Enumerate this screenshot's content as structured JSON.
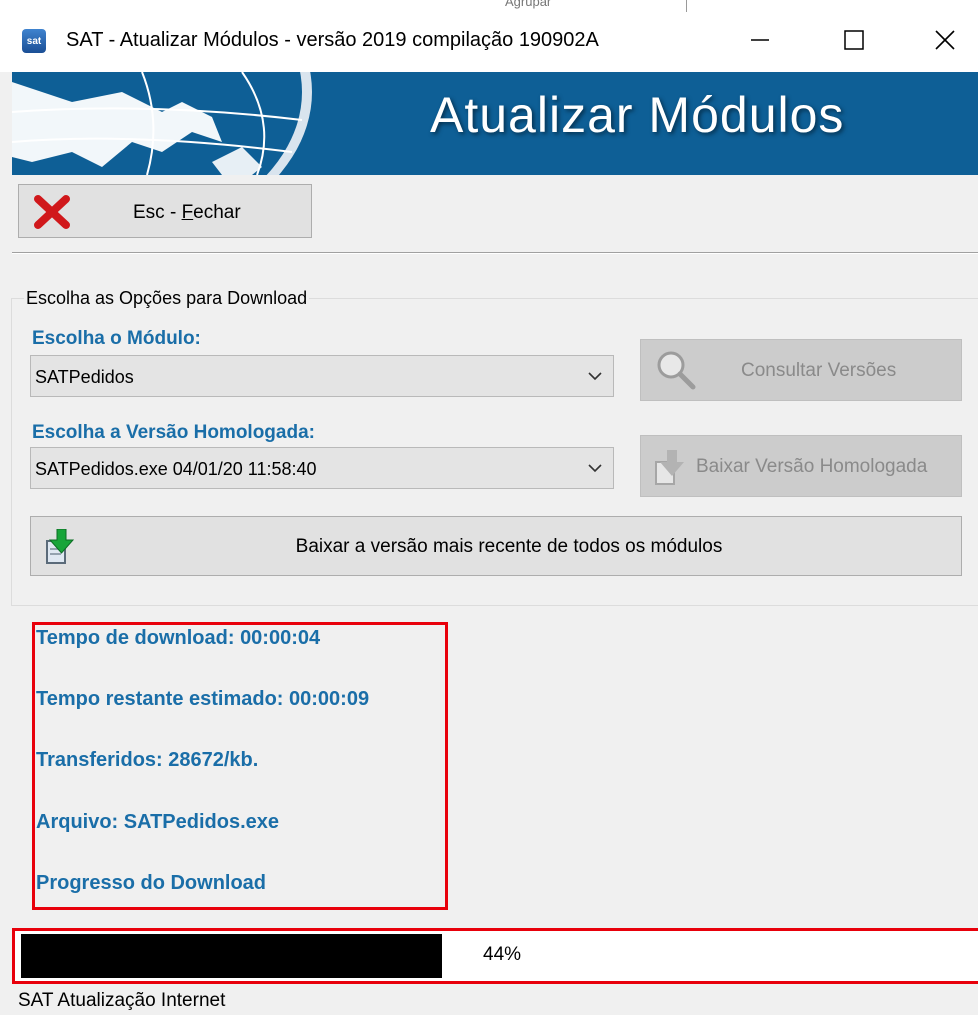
{
  "window": {
    "title": "SAT - Atualizar Módulos - versão 2019 compilação 190902A",
    "icon_label": "sat"
  },
  "background_fragment": "Agrupar",
  "banner": {
    "title": "Atualizar Módulos"
  },
  "toolbar": {
    "close_prefix": "Esc - ",
    "close_mnemonic": "F",
    "close_rest": "echar"
  },
  "download_group": {
    "legend": "Escolha as Opções para Download",
    "module_label": "Escolha o Módulo:",
    "module_value": "SATPedidos",
    "version_label": "Escolha a Versão Homologada:",
    "version_value": "SATPedidos.exe 04/01/20 11:58:40",
    "consult_button": "Consultar Versões",
    "download_version_button": "Baixar Versão Homologada",
    "download_all_button": "Baixar a versão mais recente de todos os módulos"
  },
  "info": {
    "download_time": "Tempo de download: 00:00:04",
    "remaining_time": "Tempo restante estimado: 00:00:09",
    "transferred": "Transferidos: 28672/kb.",
    "file": "Arquivo: SATPedidos.exe",
    "progress_label": "Progresso do Download"
  },
  "progress": {
    "fraction": 0.44,
    "label": "44%"
  },
  "status_bar": {
    "text": "SAT Atualização Internet"
  },
  "colors": {
    "banner": "#0e5f96",
    "label_blue": "#1a6ea8",
    "highlight_red": "#e8000b"
  }
}
